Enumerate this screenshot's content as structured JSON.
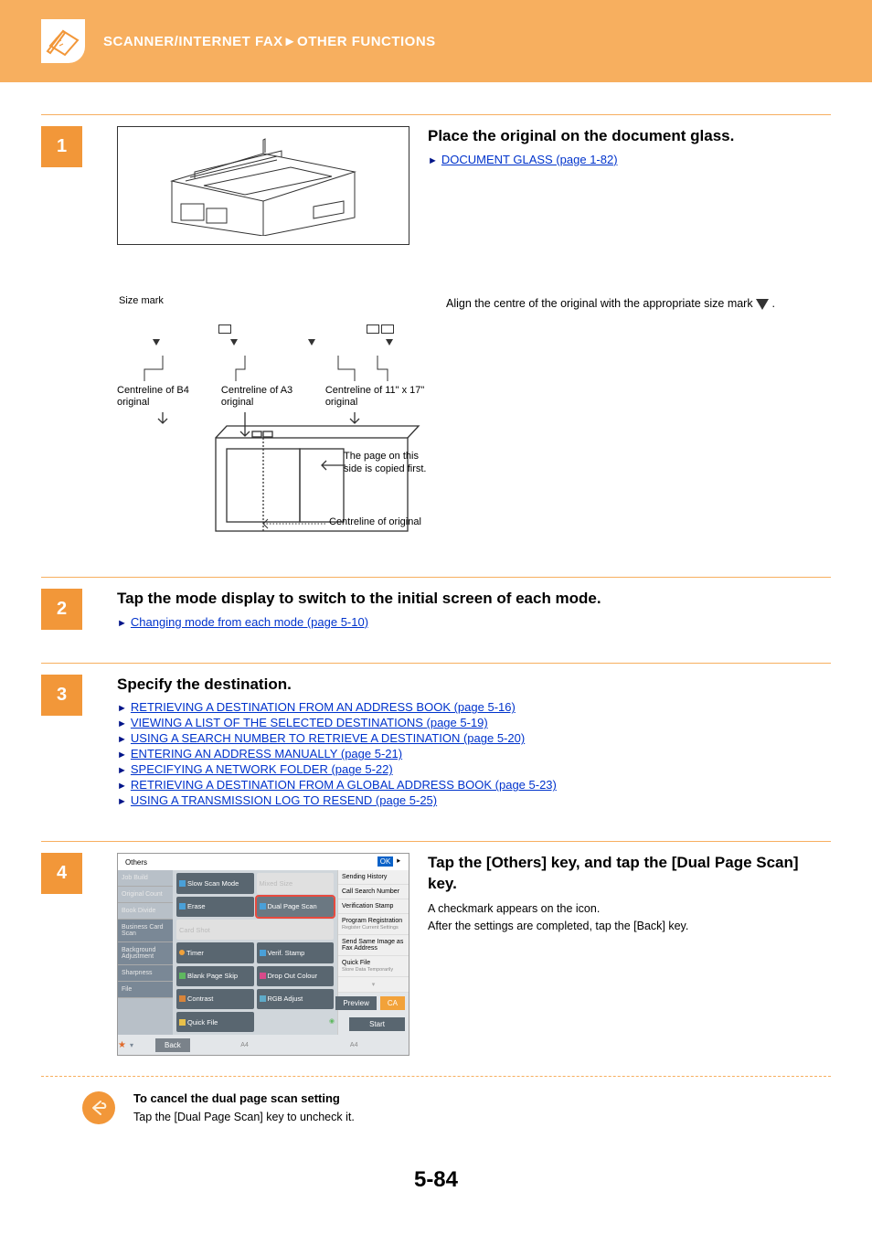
{
  "header": {
    "breadcrumb": "SCANNER/INTERNET FAX►OTHER FUNCTIONS"
  },
  "step1": {
    "title": "Place the original on the document glass.",
    "link": "DOCUMENT GLASS (page 1-82)",
    "align_note": "Align the centre of the original with the appropriate size mark ",
    "diagram": {
      "size_mark": "Size mark",
      "cl_b4": "Centreline of B4 original",
      "cl_a3": "Centreline of A3 original",
      "cl_11x17": "Centreline of 11\" x 17\" original",
      "page_side": "The page on this side is copied first.",
      "cl_orig": "Centreline of original"
    }
  },
  "step2": {
    "title": "Tap the mode display to switch to the initial screen of each mode.",
    "link": "Changing mode from each mode (page 5-10)"
  },
  "step3": {
    "title": "Specify the destination.",
    "links": [
      "RETRIEVING A DESTINATION FROM AN ADDRESS BOOK (page 5-16)",
      "VIEWING A LIST OF THE SELECTED DESTINATIONS (page 5-19)",
      "USING A SEARCH NUMBER TO RETRIEVE A DESTINATION (page 5-20)",
      "ENTERING AN ADDRESS MANUALLY (page 5-21)",
      "SPECIFYING A NETWORK FOLDER (page 5-22)",
      "RETRIEVING A DESTINATION FROM A GLOBAL ADDRESS BOOK (page 5-23)",
      "USING A TRANSMISSION LOG TO RESEND (page 5-25)"
    ]
  },
  "step4": {
    "title": "Tap the [Others] key, and tap the [Dual Page Scan] key.",
    "line1": "A checkmark appears on the icon.",
    "line2": "After the settings are completed, tap the [Back] key.",
    "panel": {
      "title": "Others",
      "ok": "OK",
      "left_tabs": [
        "Job Build",
        "Original Count",
        "Book Divide",
        "Business Card Scan",
        "Background Adjustment",
        "Sharpness",
        "File"
      ],
      "mid": {
        "slow": "Slow Scan Mode",
        "mixed": "Mixed Size",
        "erase": "Erase",
        "dual": "Dual Page Scan",
        "cardshot": "Card Shot",
        "timer": "Timer",
        "verif": "Verif. Stamp",
        "blank": "Blank Page Skip",
        "dropout": "Drop Out Colour",
        "contrast": "Contrast",
        "rgb": "RGB Adjust",
        "quick": "Quick File"
      },
      "right": [
        "Sending History",
        "Call Search Number",
        "Verification Stamp",
        "Program Registration",
        "Send Same Image as Fax Address",
        "Quick File"
      ],
      "right_sub1": "Register Current Settings",
      "right_sub2": "Store Data Temporarily",
      "back": "Back",
      "a4": "A4",
      "a4_2": "A4",
      "preview": "Preview",
      "ca": "CA",
      "start": "Start"
    }
  },
  "cancel": {
    "title": "To cancel the dual page scan setting",
    "body": "Tap the [Dual Page Scan] key to uncheck it."
  },
  "page": "5-84"
}
